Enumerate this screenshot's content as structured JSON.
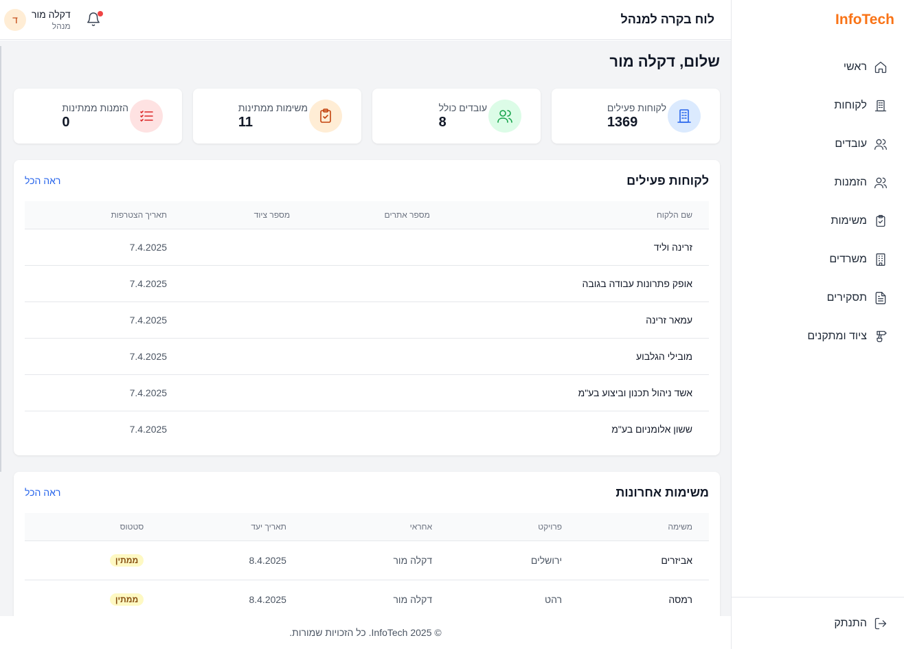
{
  "brand": "InfoTech",
  "header": {
    "title": "לוח בקרה למנהל",
    "user_name": "דקלה מור",
    "user_role": "מנהל",
    "avatar_initial": "ד"
  },
  "sidebar": {
    "items": [
      {
        "label": "ראשי",
        "icon": "home-icon"
      },
      {
        "label": "לקוחות",
        "icon": "building-icon"
      },
      {
        "label": "עובדים",
        "icon": "users-icon"
      },
      {
        "label": "הזמנות",
        "icon": "users-icon"
      },
      {
        "label": "משימות",
        "icon": "clipboard-check-icon"
      },
      {
        "label": "משרדים",
        "icon": "office-icon"
      },
      {
        "label": "תסקירים",
        "icon": "document-icon"
      },
      {
        "label": "ציוד ומתקנים",
        "icon": "drill-icon"
      }
    ],
    "logout": "התנתק"
  },
  "greeting": "שלום, דקלה מור",
  "stats": [
    {
      "label": "לקוחות פעילים",
      "value": "1369",
      "icon": "building-icon",
      "color": "#2563eb",
      "bg": "#dbeafe"
    },
    {
      "label": "עובדים כולל",
      "value": "8",
      "icon": "users-icon",
      "color": "#16a34a",
      "bg": "#dcfce7"
    },
    {
      "label": "משימות ממתינות",
      "value": "11",
      "icon": "clipboard-check-icon",
      "color": "#c2410c",
      "bg": "#ffedd5"
    },
    {
      "label": "הזמנות ממתינות",
      "value": "0",
      "icon": "list-icon",
      "color": "#dc2626",
      "bg": "#fee2e2"
    }
  ],
  "clients": {
    "title": "לקוחות פעילים",
    "see_all": "ראה הכל",
    "columns": [
      "שם הלקוח",
      "מספר אתרים",
      "מספר ציוד",
      "תאריך הצטרפות"
    ],
    "rows": [
      {
        "name": "זרינה וליד",
        "sites": "",
        "equipment": "",
        "joined": "7.4.2025"
      },
      {
        "name": "אופק פתרונות עבודה בגובה",
        "sites": "",
        "equipment": "",
        "joined": "7.4.2025"
      },
      {
        "name": "עמאר זרינה",
        "sites": "",
        "equipment": "",
        "joined": "7.4.2025"
      },
      {
        "name": "מובילי הגלבוע",
        "sites": "",
        "equipment": "",
        "joined": "7.4.2025"
      },
      {
        "name": "אשד ניהול תכנון וביצוע בע\"מ",
        "sites": "",
        "equipment": "",
        "joined": "7.4.2025"
      },
      {
        "name": "ששון אלומניום בע\"מ",
        "sites": "",
        "equipment": "",
        "joined": "7.4.2025"
      }
    ]
  },
  "tasks": {
    "title": "משימות אחרונות",
    "see_all": "ראה הכל",
    "columns": [
      "משימה",
      "פרויקט",
      "אחראי",
      "תאריך יעד",
      "סטטוס"
    ],
    "rows": [
      {
        "task": "אביזרים",
        "project": "ירושלים",
        "owner": "דקלה מור",
        "due": "8.4.2025",
        "status": "ממתין"
      },
      {
        "task": "רמסה",
        "project": "רהט",
        "owner": "דקלה מור",
        "due": "8.4.2025",
        "status": "ממתין"
      }
    ]
  },
  "footer": "© 2025 InfoTech. כל הזכויות שמורות."
}
